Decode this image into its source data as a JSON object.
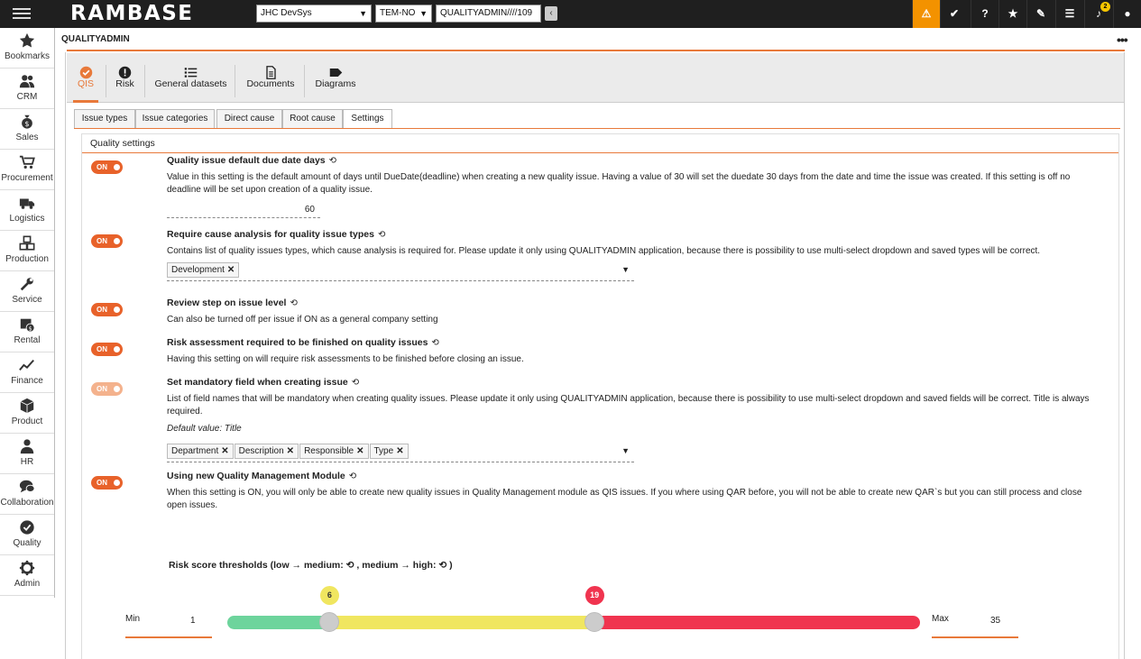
{
  "app": {
    "logo": "RAMBASE",
    "company": "JHC DevSys",
    "region": "TEM-NO",
    "path": "QUALITYADMIN////109",
    "notification_count": "2",
    "colors": {
      "accent": "#e8793a",
      "warning": "#f39200",
      "topbar": "#1f1f1f"
    }
  },
  "topbar_icons": [
    "warning-icon",
    "check-badge-icon",
    "help-icon",
    "star-icon",
    "paperclip-icon",
    "list-icon",
    "bell-icon",
    "user-icon"
  ],
  "sidebar": {
    "items": [
      {
        "label": "Bookmarks",
        "icon": "star-icon"
      },
      {
        "label": "CRM",
        "icon": "people-icon"
      },
      {
        "label": "Sales",
        "icon": "money-bag-icon"
      },
      {
        "label": "Procurement",
        "icon": "cart-icon"
      },
      {
        "label": "Logistics",
        "icon": "truck-icon"
      },
      {
        "label": "Production",
        "icon": "boxes-icon"
      },
      {
        "label": "Service",
        "icon": "wrench-icon"
      },
      {
        "label": "Rental",
        "icon": "calendar-money-icon"
      },
      {
        "label": "Finance",
        "icon": "chart-line-icon"
      },
      {
        "label": "Product",
        "icon": "cube-icon"
      },
      {
        "label": "HR",
        "icon": "person-icon"
      },
      {
        "label": "Collaboration",
        "icon": "chat-icon"
      },
      {
        "label": "Quality",
        "icon": "quality-badge-icon"
      },
      {
        "label": "Admin",
        "icon": "gear-icon"
      }
    ]
  },
  "page": {
    "title": "QUALITYADMIN",
    "more": "•••"
  },
  "main_tabs": [
    {
      "label": "QIS",
      "icon": "check-badge-icon",
      "active": true
    },
    {
      "label": "Risk",
      "icon": "exclamation-icon"
    },
    {
      "label": "General datasets",
      "icon": "list-icon"
    },
    {
      "label": "Documents",
      "icon": "document-icon"
    },
    {
      "label": "Diagrams",
      "icon": "tag-icon"
    }
  ],
  "sub_tabs": [
    {
      "label": "Issue types"
    },
    {
      "label": "Issue categories"
    },
    {
      "label": "Direct cause"
    },
    {
      "label": "Root cause"
    },
    {
      "label": "Settings",
      "active": true
    }
  ],
  "panel": {
    "title": "Quality settings"
  },
  "toggle_label": "ON",
  "settings": [
    {
      "title": "Quality issue default due date days",
      "on": true,
      "description": "Value in this setting is the default amount of days until DueDate(deadline) when creating a new quality issue. Having a value of 30 will set the duedate 30 days from the date and time the issue was created. If this setting is off no deadline will be set upon creation of a quality issue.",
      "value": "60"
    },
    {
      "title": "Require cause analysis for quality issue types",
      "on": true,
      "description": "Contains list of quality issues types, which cause analysis is required for. Please update it only using QUALITYADMIN application, because there is possibility to use multi-select dropdown and saved types will be correct.",
      "chips": [
        "Development"
      ]
    },
    {
      "title": "Review step on issue level",
      "on": true,
      "description": "Can also be turned off per issue if ON as a general company setting"
    },
    {
      "title": "Risk assessment required to be finished on quality issues",
      "on": true,
      "description": "Having this setting on will require risk assessments to be finished before closing an issue."
    },
    {
      "title": "Set mandatory field when creating issue",
      "on": true,
      "disabled": true,
      "description": "List of field names that will be mandatory when creating quality issues. Please update it only using QUALITYADMIN application, because there is possibility to use multi-select dropdown and saved fields will be correct. Title is always required.",
      "default_value": "Default value: Title",
      "chips": [
        "Department",
        "Description",
        "Responsible",
        "Type"
      ]
    },
    {
      "title": "Using new Quality Management Module",
      "on": true,
      "description": "When this setting is ON, you will only be able to create new quality issues in Quality Management module as QIS issues. If you where using QAR before, you will not be able to create new QAR`s but you can still process and close open issues."
    }
  ],
  "risk": {
    "title_part1": "Risk score thresholds (low → medium:",
    "title_part2": ", medium → high:",
    "title_part3": ")",
    "min_label": "Min",
    "min": 1,
    "max_label": "Max",
    "max": 35,
    "low_medium": 6,
    "medium_high": 19,
    "colors": {
      "low": "#6dd49c",
      "medium": "#f0e660",
      "high": "#f0344f"
    }
  }
}
